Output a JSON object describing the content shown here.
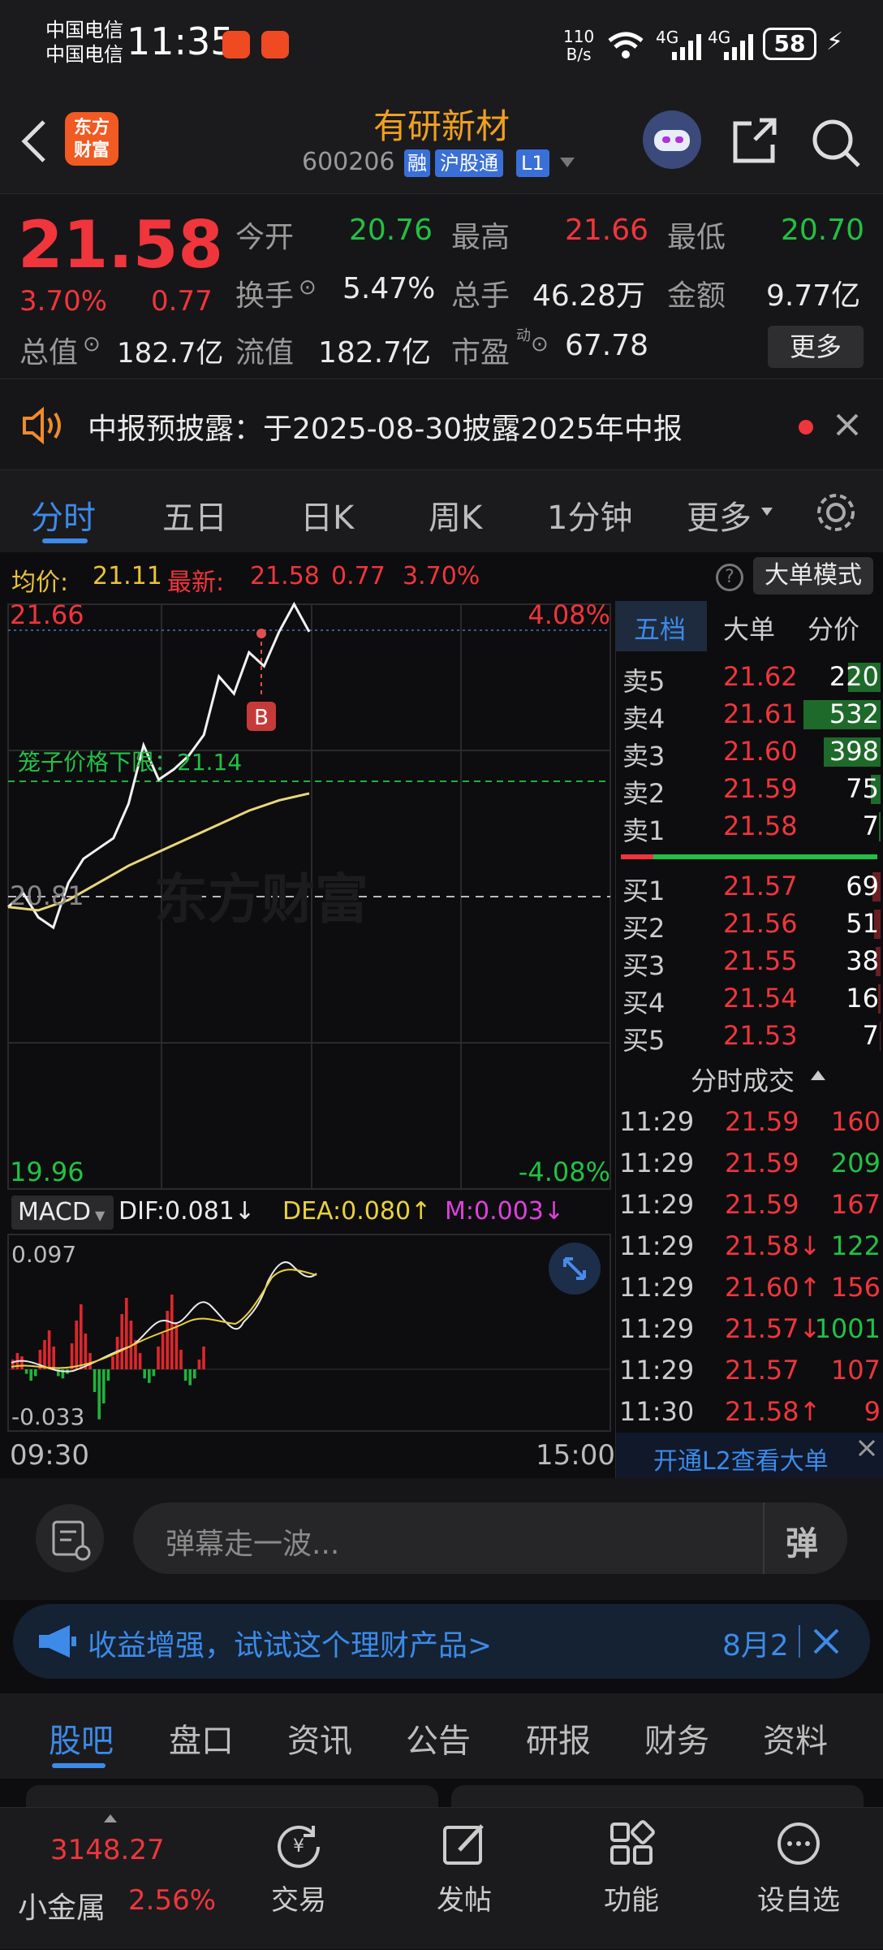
{
  "status": {
    "carrier1": "中国电信",
    "carrier2": "中国电信",
    "time": "11:35",
    "speed_top": "110",
    "speed_bottom": "B/s",
    "net1": "4G",
    "net2": "4G",
    "battery": "58"
  },
  "header": {
    "title": "有研新材",
    "code": "600206",
    "tag_rong": "融",
    "tag_hgt": "沪股通",
    "tag_level": "L1",
    "logo_line1": "东方",
    "logo_line2": "财富"
  },
  "quote": {
    "price": "21.58",
    "pct": "3.70%",
    "change": "0.77",
    "open_label": "今开",
    "open": "20.76",
    "high_label": "最高",
    "high": "21.66",
    "low_label": "最低",
    "low": "20.70",
    "turnover_label": "换手",
    "turnover": "5.47%",
    "volume_label": "总手",
    "volume": "46.28万",
    "amount_label": "金额",
    "amount": "9.77亿",
    "mktcap_label": "总值",
    "mktcap": "182.7亿",
    "float_label": "流值",
    "float": "182.7亿",
    "pe_label": "市盈",
    "pe_sup": "动",
    "pe": "67.78",
    "more": "更多"
  },
  "notice": {
    "text": "中报预披露：于2025-08-30披露2025年中报"
  },
  "periods": {
    "items": [
      "分时",
      "五日",
      "日K",
      "周K",
      "1分钟",
      "更多"
    ],
    "active": 0
  },
  "infobar": {
    "avg_label": "均价:",
    "avg": "21.11",
    "last_label": "最新:",
    "last": "21.58",
    "chg": "0.77",
    "pct": "3.70%",
    "mode_button": "大单模式"
  },
  "chart": {
    "top_price": "21.66",
    "top_pct": "4.08%",
    "bottom_price": "19.96",
    "bottom_pct": "-4.08%",
    "mid_price": "20.81",
    "limit_label": "笼子价格下限：21.14",
    "b_marker": "B",
    "watermark": "东方财富",
    "macd_label": "MACD",
    "dif": "DIF:0.081↓",
    "dea": "DEA:0.080↑",
    "m": "M:0.003↓",
    "macd_top": "0.097",
    "macd_bottom": "-0.033",
    "time_start": "09:30",
    "time_end": "15:00"
  },
  "chart_data": {
    "type": "line",
    "title": "",
    "xlim": [
      "09:30",
      "15:00"
    ],
    "ylim": [
      19.96,
      21.66
    ],
    "prev_close": 20.81,
    "series": [
      {
        "name": "最新",
        "x": [
          "09:30",
          "09:36",
          "09:42",
          "09:48",
          "09:54",
          "10:00",
          "10:06",
          "10:12",
          "10:18",
          "10:24",
          "10:30",
          "10:36",
          "10:42",
          "10:48",
          "10:54",
          "11:00",
          "11:06",
          "11:12",
          "11:18",
          "11:24",
          "11:30"
        ],
        "values": [
          20.78,
          20.82,
          20.75,
          20.72,
          20.85,
          20.92,
          20.95,
          20.98,
          21.08,
          21.25,
          21.15,
          21.18,
          21.22,
          21.28,
          21.45,
          21.4,
          21.52,
          21.48,
          21.58,
          21.66,
          21.58
        ]
      },
      {
        "name": "均价",
        "x": [
          "09:30",
          "09:42",
          "09:54",
          "10:06",
          "10:18",
          "10:30",
          "10:42",
          "10:54",
          "11:06",
          "11:18",
          "11:30"
        ],
        "values": [
          20.78,
          20.77,
          20.8,
          20.85,
          20.9,
          20.94,
          20.98,
          21.02,
          21.06,
          21.09,
          21.11
        ]
      }
    ]
  },
  "book": {
    "tabs": [
      "五档",
      "大单",
      "分价"
    ],
    "asks": [
      {
        "label": "卖5",
        "price": "21.62",
        "vol": "220",
        "bar": 0.4
      },
      {
        "label": "卖4",
        "price": "21.61",
        "vol": "532",
        "bar": 0.95
      },
      {
        "label": "卖3",
        "price": "21.60",
        "vol": "398",
        "bar": 0.7
      },
      {
        "label": "卖2",
        "price": "21.59",
        "vol": "75",
        "bar": 0.12
      },
      {
        "label": "卖1",
        "price": "21.58",
        "vol": "7",
        "bar": 0.02
      }
    ],
    "bids": [
      {
        "label": "买1",
        "price": "21.57",
        "vol": "69",
        "bar": 0.1
      },
      {
        "label": "买2",
        "price": "21.56",
        "vol": "51",
        "bar": 0.08
      },
      {
        "label": "买3",
        "price": "21.55",
        "vol": "38",
        "bar": 0.06
      },
      {
        "label": "买4",
        "price": "21.54",
        "vol": "16",
        "bar": 0.03
      },
      {
        "label": "买5",
        "price": "21.53",
        "vol": "7",
        "bar": 0.01
      }
    ],
    "ticks_title": "分时成交",
    "ticks": [
      {
        "t": "11:29",
        "p": "21.59",
        "v": "160",
        "vc": "red"
      },
      {
        "t": "11:29",
        "p": "21.59",
        "v": "209",
        "vc": "green"
      },
      {
        "t": "11:29",
        "p": "21.59",
        "v": "167",
        "vc": "red"
      },
      {
        "t": "11:29",
        "p": "21.58↓",
        "v": "122",
        "vc": "green"
      },
      {
        "t": "11:29",
        "p": "21.60↑",
        "v": "156",
        "vc": "red"
      },
      {
        "t": "11:29",
        "p": "21.57↓",
        "v": "1001",
        "vc": "green"
      },
      {
        "t": "11:29",
        "p": "21.57",
        "v": "107",
        "vc": "red"
      },
      {
        "t": "11:30",
        "p": "21.58↑",
        "v": "9",
        "vc": "red"
      }
    ],
    "l2_link": "开通L2查看大单"
  },
  "danmu": {
    "placeholder": "弹幕走一波...",
    "button": "弹"
  },
  "ad": {
    "text": "收益增强，试试这个理财产品>",
    "date": "8月2"
  },
  "tabs": {
    "items": [
      "股吧",
      "盘口",
      "资讯",
      "公告",
      "研报",
      "财务",
      "资料"
    ],
    "active": 0
  },
  "bottom": {
    "index_value": "3148.27",
    "index_name": "小金属",
    "index_pct": "2.56%",
    "items": [
      "交易",
      "发帖",
      "功能",
      "设自选"
    ]
  }
}
